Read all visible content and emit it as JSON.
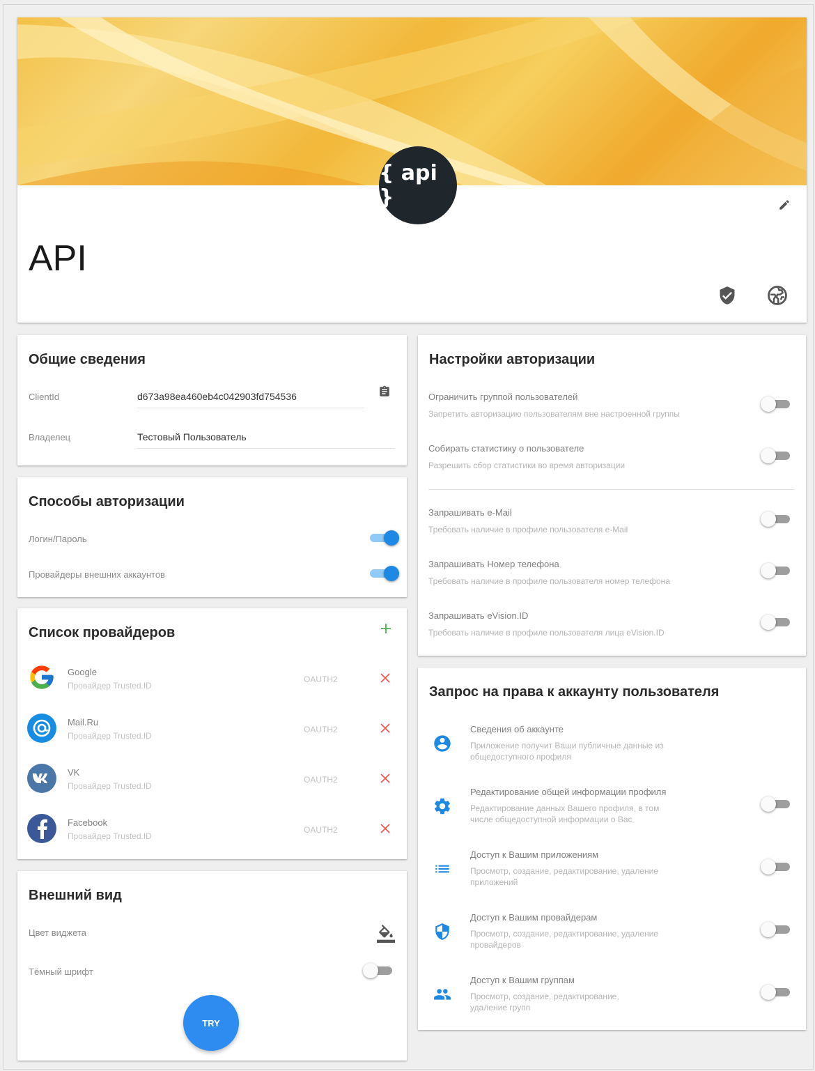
{
  "app": {
    "title": "API",
    "logo_text": "{ api }"
  },
  "header_icons": [
    "edit-icon",
    "shield-check-icon",
    "globe-icon"
  ],
  "general": {
    "title": "Общие сведения",
    "client_id_label": "ClientId",
    "client_id_value": "d673a98ea460eb4c042903fd754536",
    "owner_label": "Владелец",
    "owner_value": "Тестовый Пользователь"
  },
  "auth_methods": {
    "title": "Способы авторизации",
    "items": [
      {
        "label": "Логин/Пароль",
        "on": true
      },
      {
        "label": "Провайдеры внешних аккаунтов",
        "on": true
      }
    ]
  },
  "providers": {
    "title": "Список провайдеров",
    "items": [
      {
        "name": "Google",
        "desc": "Провайдер Trusted.ID",
        "protocol": "OAUTH2",
        "icon": "google-icon"
      },
      {
        "name": "Mail.Ru",
        "desc": "Провайдер Trusted.ID",
        "protocol": "OAUTH2",
        "icon": "mailru-icon"
      },
      {
        "name": "VK",
        "desc": "Провайдер Trusted.ID",
        "protocol": "OAUTH2",
        "icon": "vk-icon"
      },
      {
        "name": "Facebook",
        "desc": "Провайдер Trusted.ID",
        "protocol": "OAUTH2",
        "icon": "facebook-icon"
      }
    ]
  },
  "appearance": {
    "title": "Внешний вид",
    "color_label": "Цвет виджета",
    "dark_font_label": "Тёмный шрифт",
    "dark_font_on": false,
    "try_label": "TRY"
  },
  "auth_settings": {
    "title": "Настройки авторизации",
    "items": [
      {
        "title": "Ограничить группой пользователей",
        "desc": "Запретить авторизацию пользователям вне настроенной группы",
        "on": false
      },
      {
        "title": "Собирать статистику о пользователе",
        "desc": "Разрешить сбор статистики во время авторизации",
        "on": false
      },
      {
        "title": "Запрашивать e-Mail",
        "desc": "Требовать наличие в профиле пользователя e-Mail",
        "on": false
      },
      {
        "title": "Запрашивать Номер телефона",
        "desc": "Требовать наличие в профиле пользователя номер телефона",
        "on": false
      },
      {
        "title": "Запрашивать eVision.ID",
        "desc": "Требовать наличие в профиле пользователя лица eVision.ID",
        "on": false
      }
    ]
  },
  "permissions": {
    "title": "Запрос на права к аккаунту пользователя",
    "accent": "#1e88e5",
    "items": [
      {
        "title": "Сведения об аккаунте",
        "desc1": "Приложение получит Ваши публичные данные из",
        "desc2": "общедоступного профиля",
        "icon": "account-circle-icon",
        "has_toggle": false
      },
      {
        "title": "Редактирование общей информации профиля",
        "desc1": "Редактирование данных Вашего профиля, в том",
        "desc2": "числе общедоступной информации о Вас",
        "icon": "gear-icon",
        "has_toggle": true,
        "on": false
      },
      {
        "title": "Доступ к Вашим приложениям",
        "desc1": "Просмотр, создание, редактирование, удаление",
        "desc2": "приложений",
        "icon": "list-icon",
        "has_toggle": true,
        "on": false
      },
      {
        "title": "Доступ к Вашим провайдерам",
        "desc1": "Просмотр, создание, редактирование, удаление",
        "desc2": "провайдеров",
        "icon": "security-shield-icon",
        "has_toggle": true,
        "on": false
      },
      {
        "title": "Доступ к Вашим группам",
        "desc1": "Просмотр, создание, редактирование,",
        "desc2": "удаление групп",
        "icon": "group-icon",
        "has_toggle": true,
        "on": false
      }
    ]
  }
}
